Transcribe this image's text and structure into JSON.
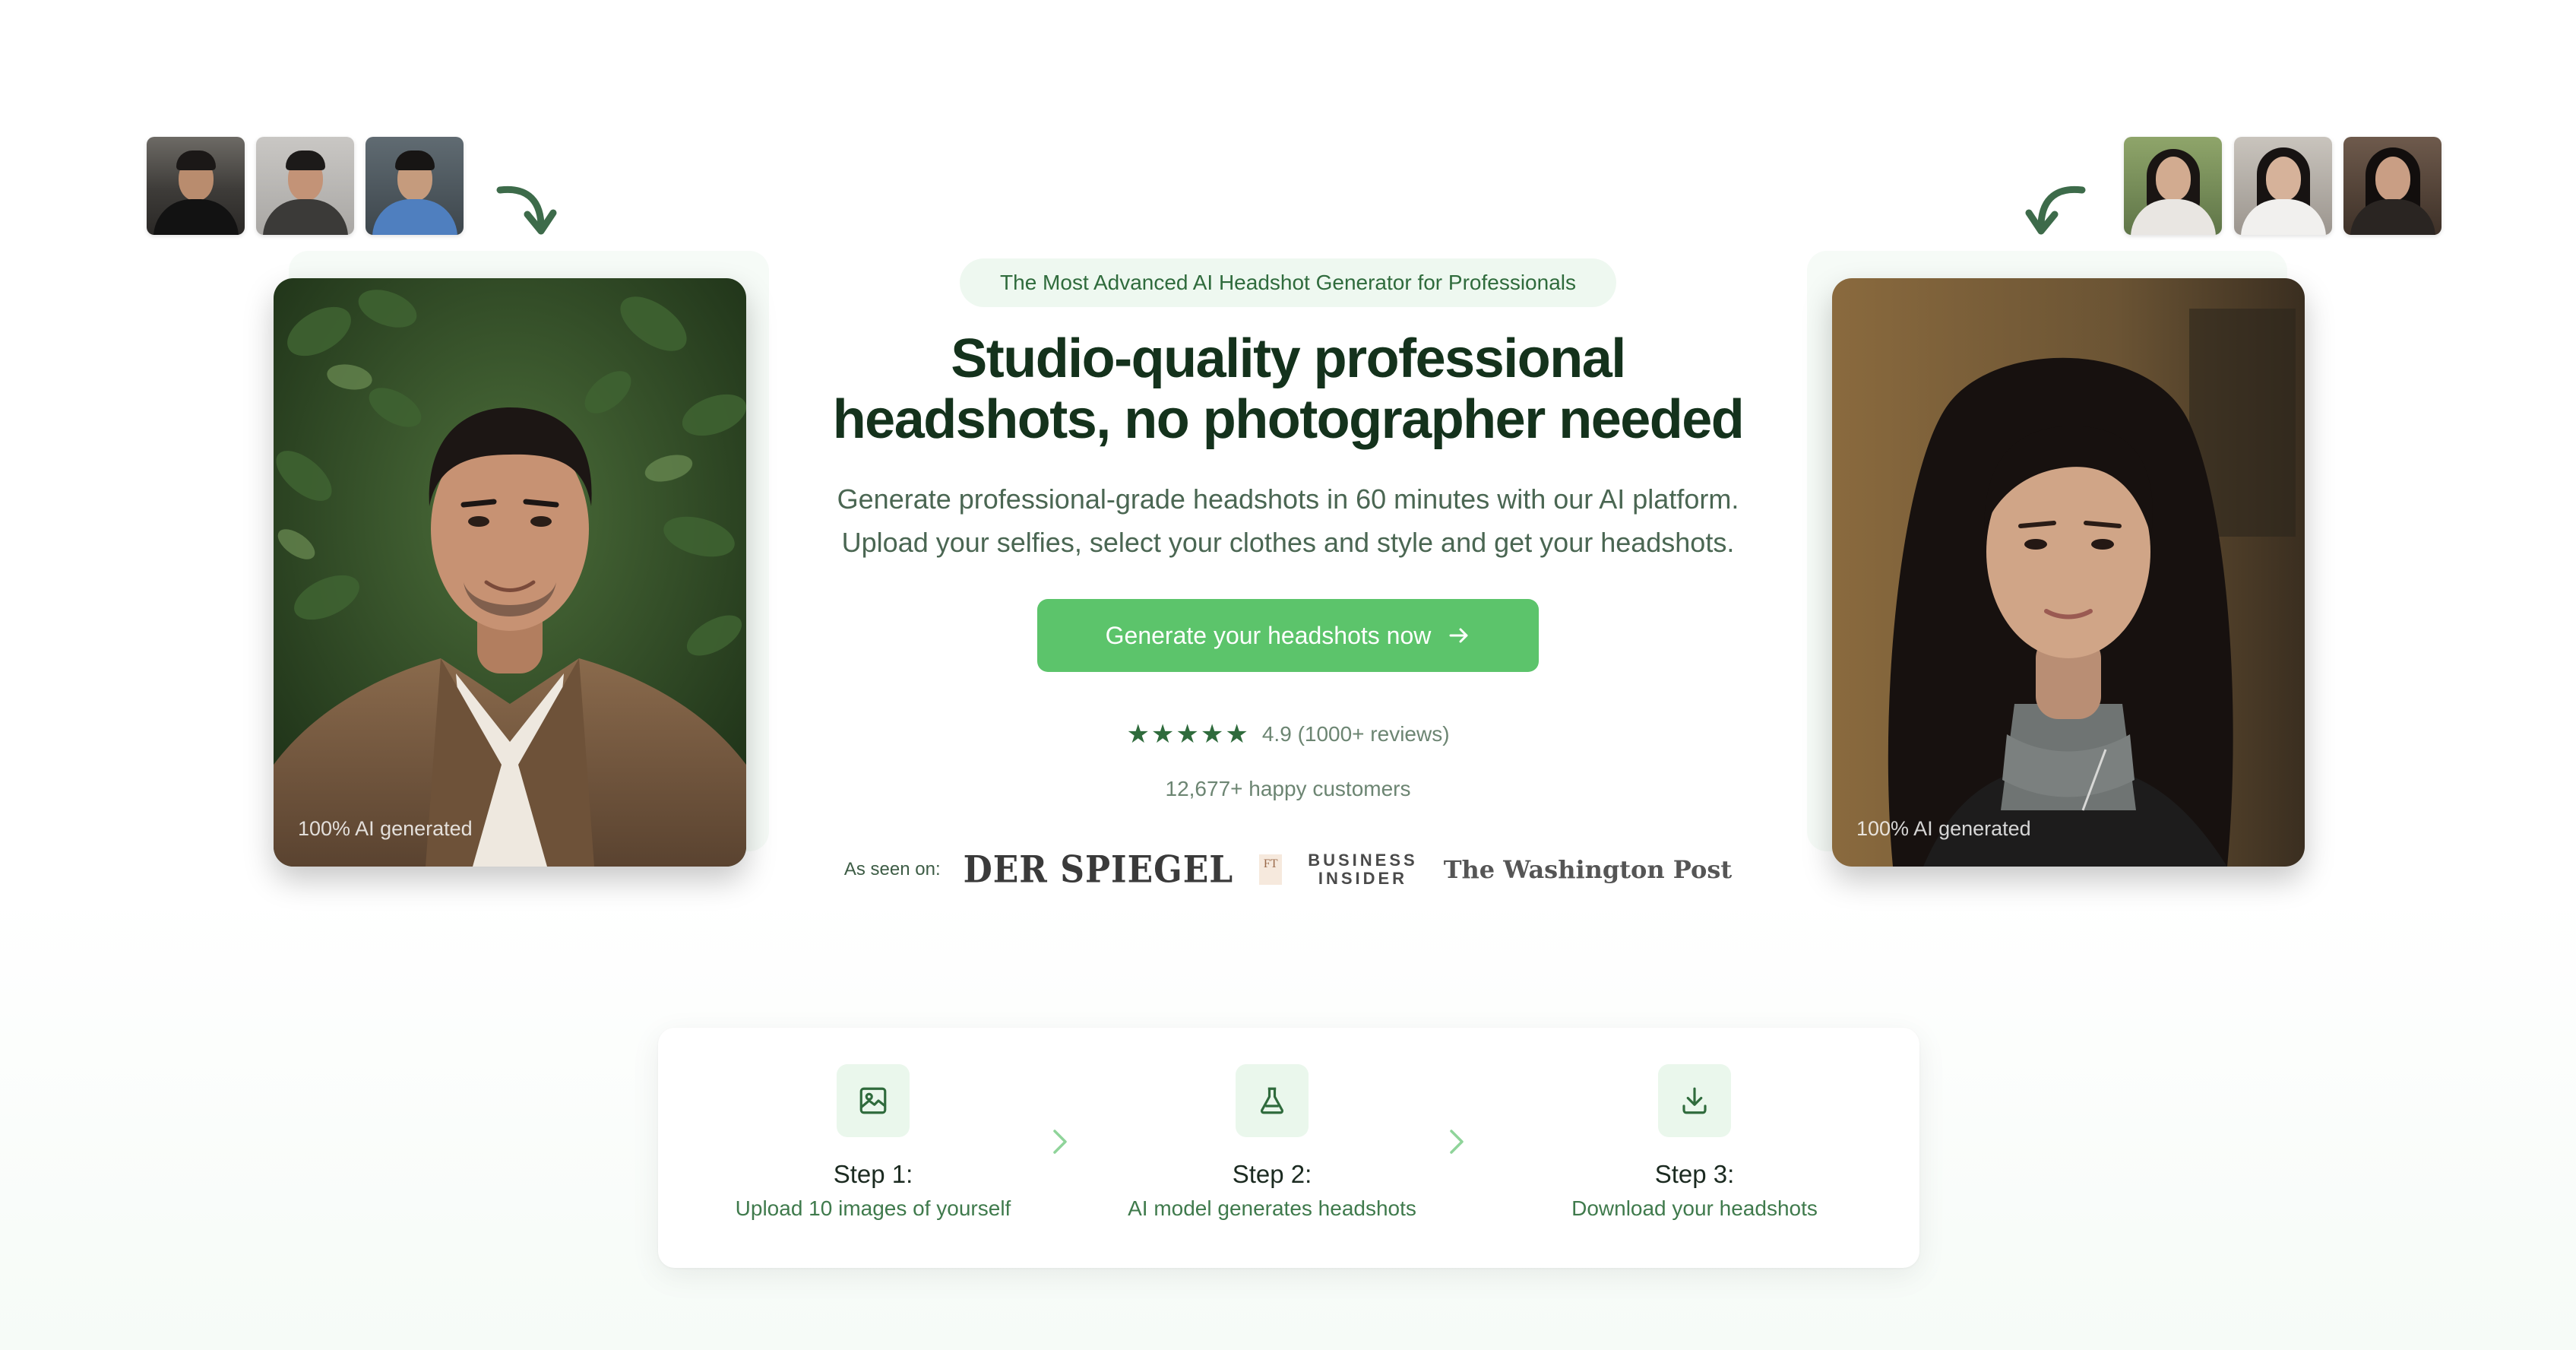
{
  "hero": {
    "badge": "The Most Advanced AI Headshot Generator for Professionals",
    "title_line1": "Studio-quality professional",
    "title_line2": "headshots, no photographer needed",
    "subtitle_line1": "Generate professional-grade headshots in 60 minutes with our AI platform.",
    "subtitle_line2": "Upload your selfies, select your clothes and style and get your headshots.",
    "cta_label": "Generate your headshots now",
    "cta_icon": "arrow-right-icon",
    "stars": "★★★★★",
    "rating_text": "4.9 (1000+ reviews)",
    "customers": "12,677+ happy customers"
  },
  "as_seen_on": {
    "label": "As seen on:",
    "logos": {
      "spiegel": "DER SPIEGEL",
      "ft": "FT",
      "business_insider_line1": "BUSINESS",
      "business_insider_line2": "INSIDER",
      "washington_post": "The Washington Post"
    }
  },
  "examples": {
    "left_caption": "100% AI generated",
    "right_caption": "100% AI generated"
  },
  "steps": [
    {
      "title": "Step 1:",
      "desc": "Upload 10 images of yourself",
      "icon": "image-icon"
    },
    {
      "title": "Step 2:",
      "desc": "AI model generates headshots",
      "icon": "flask-icon"
    },
    {
      "title": "Step 3:",
      "desc": "Download your headshots",
      "icon": "download-icon"
    }
  ],
  "colors": {
    "brand_green": "#5cc46b",
    "dark_green": "#14321c",
    "accent_text": "#3f7a4c",
    "badge_bg": "#eef8f0"
  }
}
